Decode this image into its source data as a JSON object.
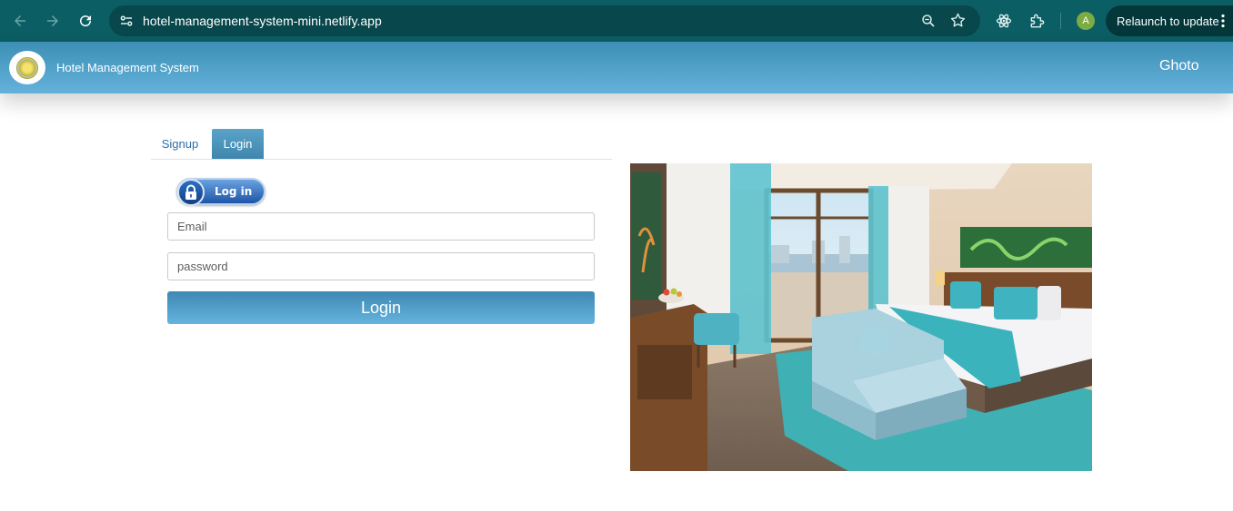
{
  "browser": {
    "url": "hotel-management-system-mini.netlify.app",
    "relaunch_label": "Relaunch to update",
    "profile_initial": "A",
    "icons": [
      "back-icon",
      "forward-icon",
      "reload-icon",
      "site-info-icon",
      "zoom-icon",
      "bookmark-star-icon",
      "extension-atom-icon",
      "extensions-puzzle-icon",
      "more-dots-icon"
    ]
  },
  "header": {
    "title": "Hotel Management System",
    "user_name": "Ghoto",
    "logo_icon": "hotel-logo-icon"
  },
  "tabs": [
    {
      "label": "Signup",
      "active": false
    },
    {
      "label": "Login",
      "active": true
    }
  ],
  "login_form": {
    "badge_text": "Log in",
    "badge_icon": "lock-icon",
    "email_placeholder": "Email",
    "email_value": "",
    "password_placeholder": "password",
    "password_value": "",
    "submit_label": "Login"
  },
  "colors": {
    "browser_bar": "#0b5e63",
    "header_gradient_top": "#3d8fb5",
    "header_gradient_bottom": "#64b2dc",
    "button_gradient_top": "#3f88b3",
    "button_gradient_bottom": "#64b4de",
    "link": "#2f6faa"
  }
}
